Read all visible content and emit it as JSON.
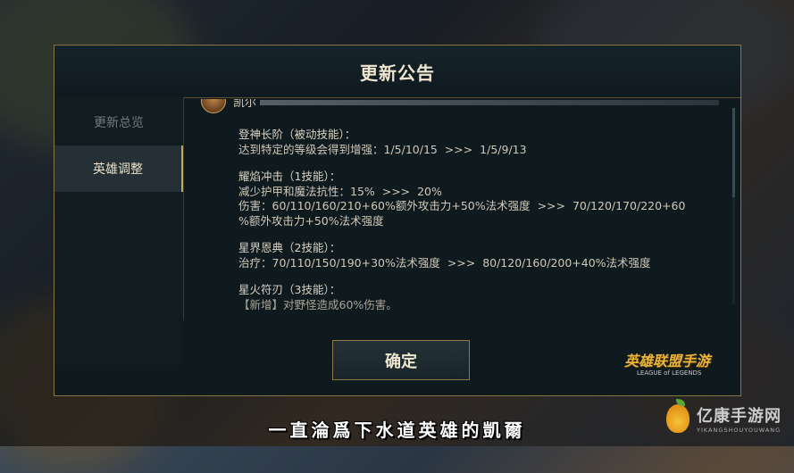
{
  "dialog": {
    "title": "更新公告",
    "tabs": [
      {
        "label": "更新总览",
        "active": false
      },
      {
        "label": "英雄调整",
        "active": true
      }
    ],
    "hero": {
      "name": "凯尔"
    },
    "abilities": [
      {
        "name": "登神长阶（被动技能）：",
        "lines": [
          "达到特定的等级会得到增强：1/5/10/15  >>>  1/5/9/13"
        ]
      },
      {
        "name": "耀焰冲击（1技能）：",
        "lines": [
          "减少护甲和魔法抗性：15%  >>>  20%",
          "伤害：60/110/160/210+60%额外攻击力+50%法术强度  >>>  70/120/170/220+60",
          "%额外攻击力+50%法术强度"
        ]
      },
      {
        "name": "星界恩典（2技能）：",
        "lines": [
          "治疗：70/110/150/190+30%法术强度  >>>  80/120/160/200+40%法术强度"
        ]
      },
      {
        "name": "星火符刃（3技能）：",
        "lines": [
          "【新增】对野怪造成60%伤害。"
        ]
      }
    ],
    "confirm_label": "确定",
    "logo": {
      "main": "英雄联盟手游",
      "sub": "LEAGUE of LEGENDS"
    }
  },
  "subtitle": "一直淪爲下水道英雄的凱爾",
  "watermark": {
    "name": "亿康手游网",
    "sub": "YIKANGSHOUYOUWANG"
  }
}
